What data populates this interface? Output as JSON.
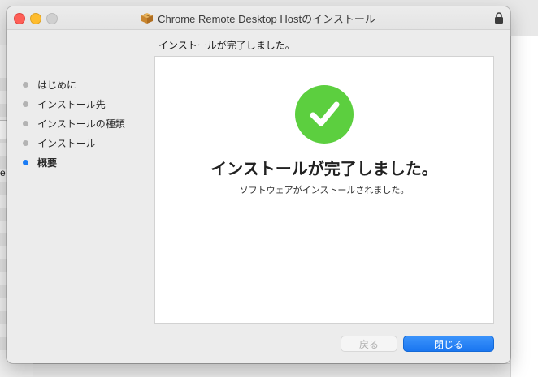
{
  "window": {
    "title": "Chrome Remote Desktop Hostのインストール"
  },
  "heading": "インストールが完了しました。",
  "steps": [
    {
      "label": "はじめに",
      "active": false
    },
    {
      "label": "インストール先",
      "active": false
    },
    {
      "label": "インストールの種類",
      "active": false
    },
    {
      "label": "インストール",
      "active": false
    },
    {
      "label": "概要",
      "active": true
    }
  ],
  "content": {
    "status_icon": "checkmark-circle-icon",
    "title": "インストールが完了しました。",
    "subtitle": "ソフトウェアがインストールされました。"
  },
  "buttons": {
    "back_label": "戻る",
    "close_label": "閉じる"
  },
  "background": {
    "partial_text": "e"
  },
  "colors": {
    "accent": "#1a7cf5",
    "success": "#5ccf3f",
    "close_traffic": "#fe5f57",
    "minimize_traffic": "#febc2e"
  }
}
